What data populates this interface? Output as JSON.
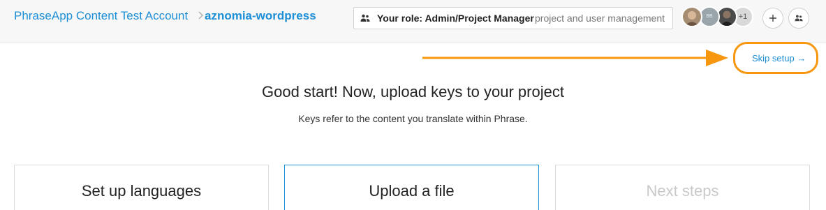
{
  "breadcrumb": {
    "account": "PhraseApp Content Test Account",
    "project": "aznomia-wordpress"
  },
  "role": {
    "label": "Your role: Admin/Project Manager",
    "description": "project and user management"
  },
  "avatars": {
    "initials": "BB",
    "more": "+1"
  },
  "skip": {
    "label": "Skip setup →"
  },
  "main": {
    "heading": "Good start! Now, upload keys to your project",
    "subtext": "Keys refer to the content you translate within Phrase."
  },
  "steps": [
    {
      "title": "Set up languages"
    },
    {
      "title": "Upload a file"
    },
    {
      "title": "Next steps"
    }
  ],
  "colors": {
    "link": "#1d8fd6",
    "highlight": "#f7960f",
    "disabled": "#c9c9c9"
  }
}
